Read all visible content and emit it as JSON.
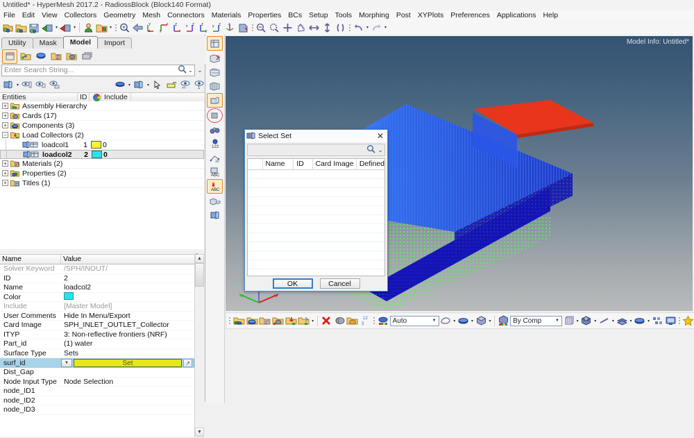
{
  "window": {
    "title": "Untitled* - HyperMesh 2017.2 - RadiossBlock (Block140 Format)"
  },
  "menu": {
    "items": [
      "File",
      "Edit",
      "View",
      "Collectors",
      "Geometry",
      "Mesh",
      "Connectors",
      "Materials",
      "Properties",
      "BCs",
      "Setup",
      "Tools",
      "Morphing",
      "Post",
      "XYPlots",
      "Preferences",
      "Applications",
      "Help"
    ]
  },
  "toolbar": {
    "groups": [
      {
        "icons": [
          "open-model-icon",
          "open-folder-icon",
          "save-icon",
          "import-icon",
          "export-icon"
        ]
      },
      {
        "icons": [
          "user-profile-icon",
          "color-folder-icon"
        ]
      },
      {
        "icons": [
          "zoom-fit-icon",
          "back-arrow-icon",
          "view-xy-icon",
          "view-yx-icon",
          "view-zx-icon",
          "view-xz-icon",
          "view-zy-icon",
          "view-yz-icon",
          "view-iso-icon",
          "rotate-view-icon"
        ]
      },
      {
        "icons": [
          "zoom-in-icon",
          "zoom-out-icon",
          "zoom-window-icon",
          "pan-icon",
          "arrow-horizontal-icon",
          "arrow-vertical-icon",
          "clipping-icon"
        ]
      },
      {
        "icons": [
          "undo-icon",
          "redo-icon"
        ]
      }
    ]
  },
  "left_panel": {
    "tabs": [
      {
        "label": "Utility",
        "active": false
      },
      {
        "label": "Mask",
        "active": false
      },
      {
        "label": "Model",
        "active": true
      },
      {
        "label": "Import",
        "active": false
      }
    ],
    "mode_tools": [
      "model-browser-icon",
      "solver-browser-icon",
      "component-browser-icon",
      "include-browser-icon",
      "card-browser-icon",
      "part-browser-icon"
    ],
    "search": {
      "placeholder": "Enter Search String...",
      "value": "",
      "icons": [
        "search-icon",
        "chevron-down-icon",
        "expand-rows-icon"
      ]
    },
    "view_tools": [
      "display-panel-icon",
      "isolate-icon",
      "isolate-only-icon",
      "show-hide-icon",
      "shaded-icon",
      "geometry-icon",
      "pick-cursor-icon",
      "mask-icon",
      "eye-plusminus-icon",
      "eye-one-icon"
    ],
    "columns": [
      "Entities",
      "ID",
      "color-wheel-icon",
      "Include"
    ],
    "tree": [
      {
        "label": "Assembly Hierarchy",
        "icon": "assembly-icon",
        "indent": 0,
        "expandable": true,
        "id": "",
        "color": "",
        "include": "",
        "selected": false
      },
      {
        "label": "Cards (17)",
        "icon": "cards-icon",
        "indent": 0,
        "expandable": true,
        "id": "",
        "color": "",
        "include": "",
        "selected": false
      },
      {
        "label": "Components (3)",
        "icon": "components-icon",
        "indent": 0,
        "expandable": true,
        "id": "",
        "color": "",
        "include": "",
        "selected": false
      },
      {
        "label": "Load Collectors (2)",
        "icon": "loadcollectors-icon",
        "indent": 0,
        "expandable": true,
        "expanded": true,
        "id": "",
        "color": "",
        "include": "",
        "selected": false
      },
      {
        "label": "loadcol1",
        "icon": "loadcol-icon",
        "indent": 1,
        "expandable": false,
        "id": "1",
        "color": "#f5f52c",
        "include": "0",
        "selected": false
      },
      {
        "label": "loadcol2",
        "icon": "loadcol-icon",
        "indent": 1,
        "expandable": false,
        "id": "2",
        "color": "#22e5f0",
        "include": "0",
        "selected": true
      },
      {
        "label": "Materials (2)",
        "icon": "materials-icon",
        "indent": 0,
        "expandable": true,
        "id": "",
        "color": "",
        "include": "",
        "selected": false
      },
      {
        "label": "Properties (2)",
        "icon": "properties-icon",
        "indent": 0,
        "expandable": true,
        "id": "",
        "color": "",
        "include": "",
        "selected": false
      },
      {
        "label": "Titles (1)",
        "icon": "titles-icon",
        "indent": 0,
        "expandable": true,
        "id": "",
        "color": "",
        "include": "",
        "selected": false
      }
    ],
    "property_grid": {
      "columns": [
        "Name",
        "Value"
      ],
      "rows": [
        {
          "name": "Solver Keyword",
          "value": "/SPH/INOUT/",
          "dim": true,
          "type": "text"
        },
        {
          "name": "ID",
          "value": "2",
          "dim": false,
          "type": "text"
        },
        {
          "name": "Name",
          "value": "loadcol2",
          "dim": false,
          "type": "text"
        },
        {
          "name": "Color",
          "value": "",
          "dim": false,
          "type": "color",
          "color": "#22e5f0"
        },
        {
          "name": "Include",
          "value": "[Master Model]",
          "dim": true,
          "type": "text"
        },
        {
          "name": "User Comments",
          "value": "Hide In Menu/Export",
          "dim": false,
          "type": "text"
        },
        {
          "name": "Card Image",
          "value": "SPH_INLET_OUTLET_Collector",
          "dim": false,
          "type": "text"
        },
        {
          "name": "ITYP",
          "value": "3: Non-reflective frontiers (NRF)",
          "dim": false,
          "type": "text"
        },
        {
          "name": "Part_id",
          "value": "(1) water",
          "dim": false,
          "type": "text"
        },
        {
          "name": "Surface Type",
          "value": "Sets",
          "dim": false,
          "type": "text"
        },
        {
          "name": "surf_id",
          "value": "Set",
          "dim": false,
          "type": "setbutton",
          "active": true
        },
        {
          "name": "Dist_Gap",
          "value": "",
          "dim": false,
          "type": "text"
        },
        {
          "name": "Node Input Type",
          "value": "Node Selection",
          "dim": false,
          "type": "text"
        },
        {
          "name": "node_ID1",
          "value": "",
          "dim": false,
          "type": "text"
        },
        {
          "name": "node_ID2",
          "value": "",
          "dim": false,
          "type": "text"
        },
        {
          "name": "node_ID3",
          "value": "",
          "dim": false,
          "type": "text"
        }
      ]
    }
  },
  "viewport": {
    "model_info": "Model Info: Untitled*",
    "side_tools": [
      "mesh-display-icon",
      "mesh-delete-icon",
      "mesh-edit-icon",
      "mesh-faces-icon",
      "mesh-elements-icon",
      "mesh-circle-icon",
      "binoculars-icon",
      "node-info-icon",
      "measure-icon",
      "abc-label-icon",
      "abc-text-icon",
      "mesh-transform-icon",
      "component-icon"
    ],
    "bottom_toolbar": {
      "left_icons": [
        "components-icon",
        "comp-blue-icon",
        "include-icon",
        "element-icon",
        "import-solver-icon",
        "export-solver-icon",
        "delete-red-icon",
        "mesh-gray-icon",
        "open-folder-icon",
        "numbers-icon"
      ],
      "color_mode": "Auto",
      "display_mode": "By Comp",
      "right_icons": [
        "wireframe-icon",
        "shaded-cube-icon",
        "line-icon",
        "mesh-lines-icon",
        "shaded-disc-icon",
        "nodes-icon",
        "monitor-icon",
        "favorite-star-icon"
      ]
    },
    "axis_triad": {
      "x_label": "X",
      "y_label": "Y",
      "z_label": "Z",
      "x_color": "#e02020",
      "y_color": "#22c222",
      "z_color": "#6a6ad0"
    },
    "model_colors": {
      "top_surface": "#e8351c",
      "mesh_blue": "#1b1bd8",
      "mesh_light_blue": "#2a6af0",
      "nodes_green": "#5cf05c"
    },
    "background": {
      "top": "#345272",
      "bottom": "#b9bbbc"
    }
  },
  "dialog": {
    "title": "Select Set",
    "title_icon": "set-icon",
    "close_icon": "close-icon",
    "search": {
      "value": "",
      "placeholder": "",
      "icons": [
        "search-icon",
        "chevron-down-icon"
      ]
    },
    "columns": [
      "Name",
      "ID",
      "Card Image",
      "Defined"
    ],
    "rows": [],
    "buttons": [
      {
        "label": "OK",
        "default": true,
        "name": "ok-button"
      },
      {
        "label": "Cancel",
        "default": false,
        "name": "cancel-button"
      }
    ]
  }
}
